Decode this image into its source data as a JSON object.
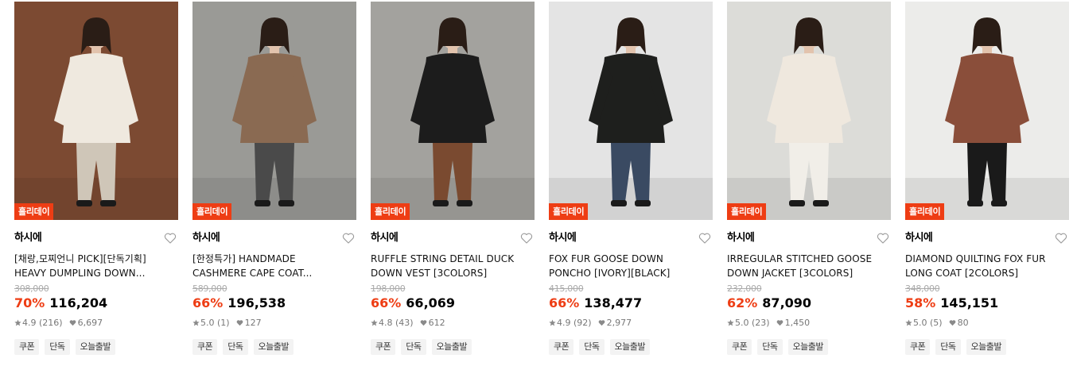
{
  "products": [
    {
      "badge": "홀리데이",
      "brand": "하시에",
      "name_line1": "[채랑,모찌언니 PICK][단독기획]",
      "name_line2": "HEAVY DUMPLING DOWN...",
      "original_price": "308,000",
      "discount": "70%",
      "price": "116,204",
      "rating": "4.9 (216)",
      "likes": "6,697",
      "tags": [
        "쿠폰",
        "단독",
        "오늘출발"
      ],
      "photo": "model in cream padded down jacket holding a mug",
      "colors": {
        "bg": "#7c4a32",
        "garment": "#efe9df",
        "pants": "#cfc6b8"
      }
    },
    {
      "badge": "홀리데이",
      "brand": "하시에",
      "name_line1": "[한정특가] HANDMADE",
      "name_line2": "CASHMERE CAPE COAT...",
      "original_price": "589,000",
      "discount": "66%",
      "price": "196,538",
      "rating": "5.0 (1)",
      "likes": "127",
      "tags": [
        "쿠폰",
        "단독",
        "오늘출발"
      ],
      "photo": "model in camel cashmere cape coat against concrete wall",
      "colors": {
        "bg": "#9a9a96",
        "garment": "#8a6a52",
        "pants": "#4a4a4a"
      }
    },
    {
      "badge": "홀리데이",
      "brand": "하시에",
      "name_line1": "RUFFLE STRING DETAIL DUCK",
      "name_line2": "DOWN VEST [3COLORS]",
      "original_price": "198,000",
      "discount": "66%",
      "price": "66,069",
      "rating": "4.8 (43)",
      "likes": "612",
      "tags": [
        "쿠폰",
        "단독",
        "오늘출발"
      ],
      "photo": "model in black down vest and brown quilted skirt",
      "colors": {
        "bg": "#a3a29e",
        "garment": "#1c1c1c",
        "pants": "#7a4a30"
      }
    },
    {
      "badge": "홀리데이",
      "brand": "하시에",
      "name_line1": "FOX FUR GOOSE DOWN",
      "name_line2": "PONCHO [IVORY][BLACK]",
      "original_price": "415,000",
      "discount": "66%",
      "price": "138,477",
      "rating": "4.9 (92)",
      "likes": "2,977",
      "tags": [
        "쿠폰",
        "단독",
        "오늘출발"
      ],
      "photo": "model in black down poncho with fox fur hood",
      "colors": {
        "bg": "#e4e4e4",
        "garment": "#1e1f1d",
        "pants": "#3a4a62"
      }
    },
    {
      "badge": "홀리데이",
      "brand": "하시에",
      "name_line1": "IRREGULAR STITCHED GOOSE",
      "name_line2": "DOWN JACKET [3COLORS]",
      "original_price": "232,000",
      "discount": "62%",
      "price": "87,090",
      "rating": "5.0 (23)",
      "likes": "1,450",
      "tags": [
        "쿠폰",
        "단독",
        "오늘출발"
      ],
      "photo": "model in ivory stitched goose down jacket and long skirt",
      "colors": {
        "bg": "#dcdcd8",
        "garment": "#efe8de",
        "pants": "#f1eee8"
      }
    },
    {
      "badge": "홀리데이",
      "brand": "하시에",
      "name_line1": "DIAMOND QUILTING FOX FUR",
      "name_line2": "LONG COAT [2COLORS]",
      "original_price": "348,000",
      "discount": "58%",
      "price": "145,151",
      "rating": "5.0 (5)",
      "likes": "80",
      "tags": [
        "쿠폰",
        "단독",
        "오늘출발"
      ],
      "photo": "model in brown diamond quilted long coat with fox fur collar",
      "colors": {
        "bg": "#ececea",
        "garment": "#8a4e3a",
        "pants": "#1a1a1a"
      }
    }
  ]
}
